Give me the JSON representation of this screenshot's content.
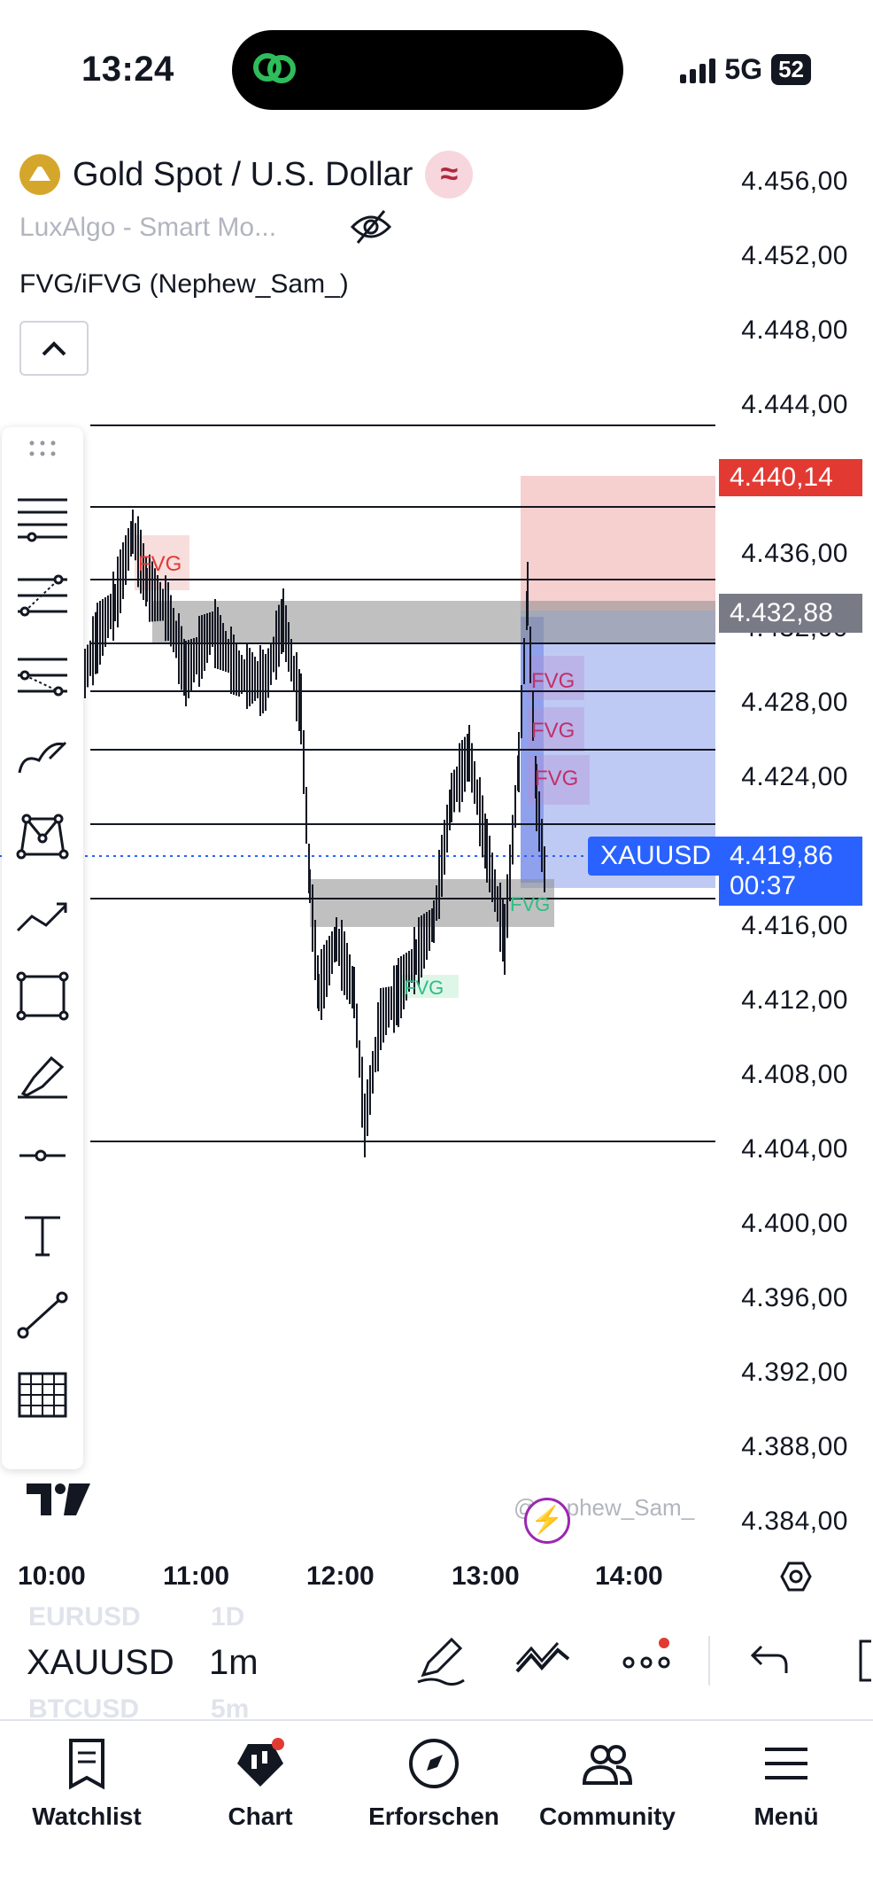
{
  "status_bar": {
    "time": "13:24",
    "network": "5G",
    "battery": "52"
  },
  "header": {
    "symbol_title": "Gold Spot / U.S. Dollar",
    "badge": "≈",
    "indicator_1": "LuxAlgo - Smart Mo...",
    "indicator_2": "FVG/iFVG (Nephew_Sam_)"
  },
  "price_axis": [
    "4.456,00",
    "4.452,00",
    "4.448,00",
    "4.444,00",
    "4.436,00",
    "4.432,00",
    "4.428,00",
    "4.424,00",
    "4.416,00",
    "4.412,00",
    "4.408,00",
    "4.404,00",
    "4.400,00",
    "4.396,00",
    "4.392,00",
    "4.388,00",
    "4.384,00"
  ],
  "price_tags": {
    "stop": "4.440,14",
    "entry": "4.432,88",
    "current_symbol": "XAUUSD",
    "current_price": "4.419,86",
    "countdown": "00:37"
  },
  "chart_labels": {
    "fvg": "FVG"
  },
  "time_axis": [
    "10:00",
    "11:00",
    "12:00",
    "13:00",
    "14:00"
  ],
  "watermark": "@Nephew_Sam_",
  "symbol_picker": {
    "prev_symbol": "EURUSD",
    "prev_interval": "1D",
    "symbol": "XAUUSD",
    "interval": "1m",
    "next_symbol": "BTCUSD",
    "next_interval": "5m"
  },
  "toolbar_tools": [
    "drag-handle",
    "horizontal-lines",
    "pitchfork",
    "fib",
    "brush",
    "pattern",
    "path",
    "rectangle",
    "highlighter",
    "horizontal-ray",
    "text",
    "trend-line",
    "grid"
  ],
  "tabs": [
    {
      "label": "Watchlist",
      "icon": "watchlist-icon"
    },
    {
      "label": "Chart",
      "icon": "chart-icon"
    },
    {
      "label": "Erforschen",
      "icon": "compass-icon"
    },
    {
      "label": "Community",
      "icon": "community-icon"
    },
    {
      "label": "Menü",
      "icon": "menu-icon"
    }
  ],
  "colors": {
    "bearish_zone": "#f4c7c7",
    "bullish_zone": "#a9b8f0",
    "price_red": "#e23a33",
    "price_blue": "#2962ff",
    "fvg_red": "#e23a33",
    "fvg_green": "#2ebd85"
  }
}
